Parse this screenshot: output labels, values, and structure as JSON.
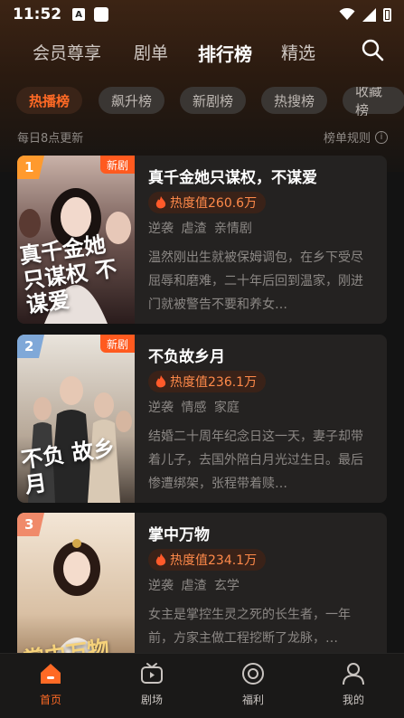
{
  "status": {
    "time": "11:52",
    "a_icon": "A"
  },
  "top_tabs": [
    {
      "label": "会员尊享"
    },
    {
      "label": "剧单"
    },
    {
      "label": "排行榜"
    },
    {
      "label": "精选"
    }
  ],
  "active_top_tab": "排行榜",
  "chips": [
    {
      "label": "热播榜"
    },
    {
      "label": "飙升榜"
    },
    {
      "label": "新剧榜"
    },
    {
      "label": "热搜榜"
    },
    {
      "label": "收藏榜"
    }
  ],
  "active_chip": "热播榜",
  "sub_header": {
    "left": "每日8点更新",
    "right": "榜单规则",
    "info_glyph": "i"
  },
  "dramas": [
    {
      "rank": "1",
      "badge": "新剧",
      "title": "真千金她只谋权，不谋爱",
      "heat": "热度值260.6万",
      "tags": "逆袭 虐渣 亲情剧",
      "desc": "温然刚出生就被保姆调包，在乡下受尽屈辱和磨难，二十年后回到温家，刚进门就被警告不要和养女…",
      "poster_title": "真千金她只谋权 不谋爱",
      "rank_color": "#ff9a2e"
    },
    {
      "rank": "2",
      "badge": "新剧",
      "title": "不负故乡月",
      "heat": "热度值236.1万",
      "tags": "逆袭 情感 家庭",
      "desc": "结婚二十周年纪念日这一天，妻子却带着儿子，去国外陪白月光过生日。最后惨遭绑架，张程带着赎…",
      "poster_title": "不负 故乡月",
      "rank_color": "#7fa8d8"
    },
    {
      "rank": "3",
      "badge": "",
      "title": "掌中万物",
      "heat": "热度值234.1万",
      "tags": "逆袭 虐渣 玄学",
      "desc": "女主是掌控生灵之死的长生者，一年前，方家主做工程挖断了龙脉，…",
      "poster_title": "掌中万物",
      "rank_color": "#f08a6a"
    }
  ],
  "bottom_nav": [
    {
      "label": "首页"
    },
    {
      "label": "剧场"
    },
    {
      "label": "福利"
    },
    {
      "label": "我的"
    }
  ],
  "active_bottom": "首页",
  "accent": "#ff6a25"
}
